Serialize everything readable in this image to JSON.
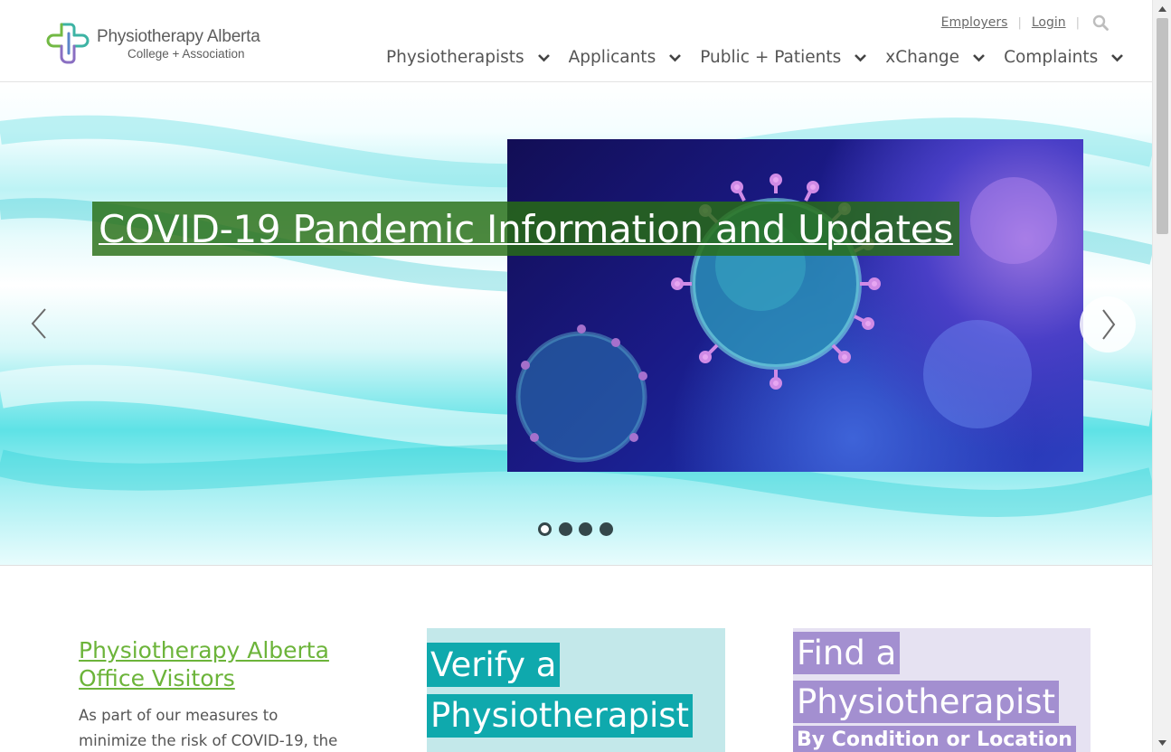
{
  "brand": {
    "name": "Physiotherapy Alberta",
    "subtitle": "College + Association",
    "colors": {
      "green": "#6cb43a",
      "teal": "#0fa9ad",
      "purple": "#a38fd0"
    }
  },
  "utility_nav": {
    "employers": "Employers",
    "login": "Login",
    "search_icon": "magnifier"
  },
  "main_nav": {
    "items": [
      {
        "label": "Physiotherapists"
      },
      {
        "label": "Applicants"
      },
      {
        "label": "Public + Patients"
      },
      {
        "label": "xChange"
      },
      {
        "label": "Complaints"
      }
    ]
  },
  "hero": {
    "title": "COVID-19 Pandemic Information and Updates",
    "image": "coronavirus-illustration",
    "slide_count": 4,
    "active_slide": 1
  },
  "visitors": {
    "title": "Physiotherapy Alberta Office Visitors",
    "body": "As part of our measures to minimize the risk of COVID-19, the"
  },
  "tiles": {
    "verify": {
      "line1": "Verify a",
      "line2": "Physiotherapist"
    },
    "find": {
      "line1": "Find a",
      "line2": "Physiotherapist",
      "line3": "By Condition or Location"
    }
  }
}
